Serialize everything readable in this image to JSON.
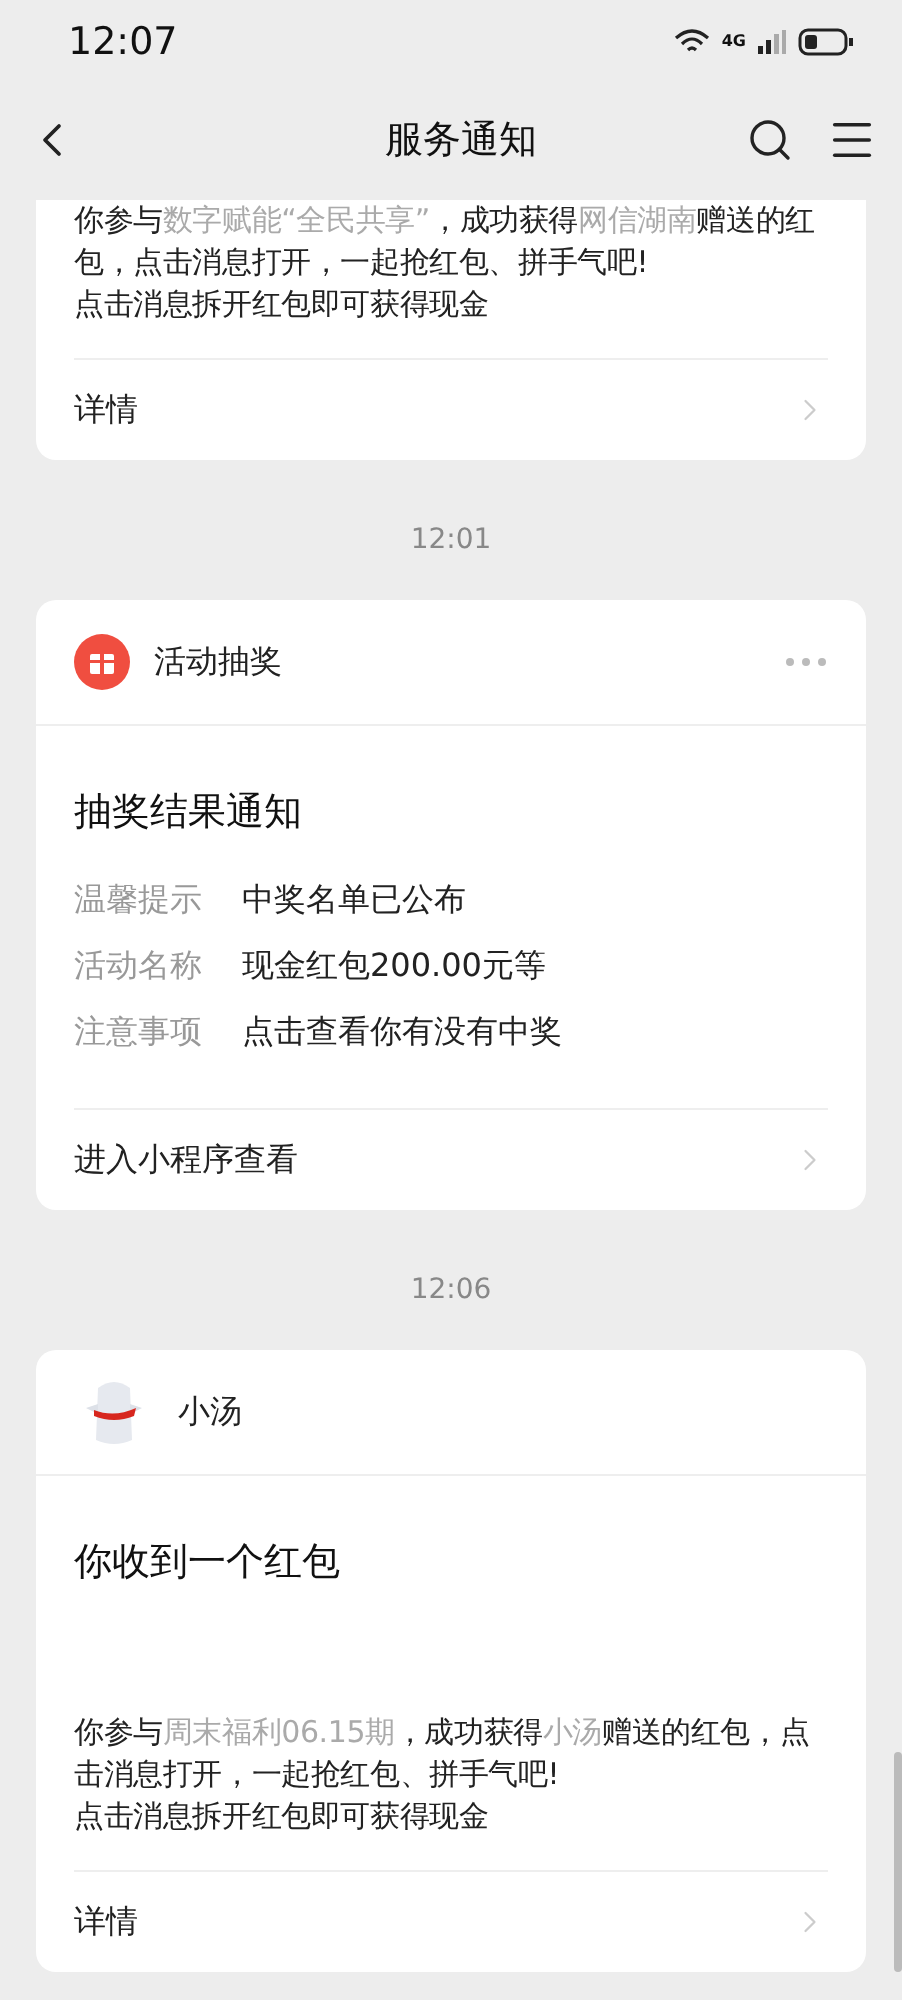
{
  "status_bar": {
    "time": "12:07",
    "network": "4G"
  },
  "nav": {
    "title": "服务通知"
  },
  "feed": [
    {
      "kind": "card",
      "body": [
        {
          "text": "你参与",
          "highlight": false
        },
        {
          "text": "数字赋能“全民共享”",
          "highlight": true
        },
        {
          "text": "，成功获得",
          "highlight": false
        },
        {
          "text": "网信湖南",
          "highlight": true
        },
        {
          "text": "赠送的红包，点击消息打开，一起抢红包、拼手气吧!",
          "highlight": false
        }
      ],
      "note": "点击消息拆开红包即可获得现金",
      "footer": "详情"
    },
    {
      "kind": "time",
      "time": "12:01"
    },
    {
      "kind": "card",
      "sender": {
        "kind": "gift",
        "name": "活动抽奖"
      },
      "more_menu": true,
      "title": "抽奖结果通知",
      "fields": [
        {
          "label": "温馨提示",
          "value": "中奖名单已公布"
        },
        {
          "label": "活动名称",
          "value": "现金红包200.00元等"
        },
        {
          "label": "注意事项",
          "value": "点击查看你有没有中奖"
        }
      ],
      "footer": "进入小程序查看"
    },
    {
      "kind": "time",
      "time": "12:06"
    },
    {
      "kind": "card",
      "sender": {
        "kind": "mascot",
        "name": "小汤"
      },
      "more_menu": false,
      "title": "你收到一个红包",
      "body": [
        {
          "text": "你参与",
          "highlight": false
        },
        {
          "text": "周末福利06.15期",
          "highlight": true
        },
        {
          "text": "，成功获得",
          "highlight": false
        },
        {
          "text": "小汤",
          "highlight": true
        },
        {
          "text": "赠送的红包，点击消息打开，一起抢红包、拼手气吧!",
          "highlight": false
        }
      ],
      "note": "点击消息拆开红包即可获得现金",
      "footer": "详情"
    }
  ]
}
